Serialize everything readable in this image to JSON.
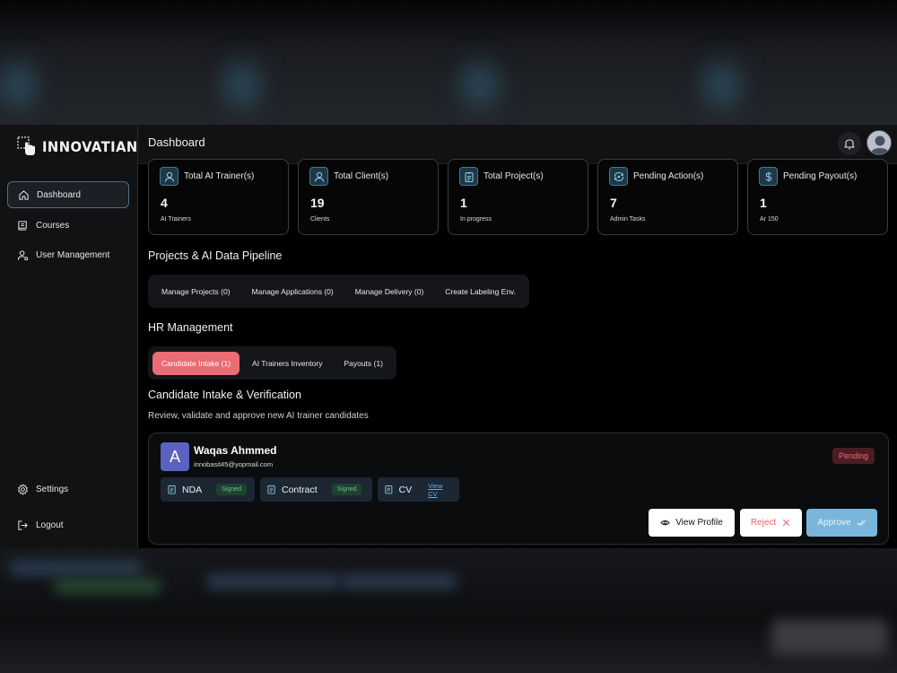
{
  "brand": {
    "name": "INNOVATIANA"
  },
  "sidebar": {
    "items": [
      {
        "label": "Dashboard",
        "icon": "home-icon",
        "active": true
      },
      {
        "label": "Courses",
        "icon": "courses-icon",
        "active": false
      },
      {
        "label": "User Management",
        "icon": "user-management-icon",
        "active": false
      }
    ],
    "bottom": [
      {
        "label": "Settings",
        "icon": "gear-icon"
      },
      {
        "label": "Logout",
        "icon": "logout-icon"
      }
    ]
  },
  "header": {
    "title": "Dashboard"
  },
  "stats": [
    {
      "title": "Total AI Trainer(s)",
      "value": "4",
      "sub": "AI Trainers",
      "icon": "user-icon"
    },
    {
      "title": "Total Client(s)",
      "value": "19",
      "sub": "Clients",
      "icon": "client-icon"
    },
    {
      "title": "Total Project(s)",
      "value": "1",
      "sub": "In progress",
      "icon": "clipboard-icon"
    },
    {
      "title": "Pending Action(s)",
      "value": "7",
      "sub": "Admin Tasks",
      "icon": "cycle-icon"
    },
    {
      "title": "Pending Payout(s)",
      "value": "1",
      "sub": "Ar 150",
      "icon": "dollar-icon"
    }
  ],
  "pipeline": {
    "title": "Projects & AI Data Pipeline",
    "tabs": [
      "Manage Projects (0)",
      "Manage Applications (0)",
      "Manage Delivery (0)",
      "Create Labeling Env."
    ]
  },
  "hr": {
    "title": "HR Management",
    "tabs": [
      "Candidate Intake (1)",
      "AI Trainers Inventory",
      "Payouts (1)"
    ]
  },
  "intake": {
    "title": "Candidate Intake & Verification",
    "subtitle": "Review, validate and approve new AI trainer candidates",
    "candidate": {
      "initial": "A",
      "name": "Waqas Ahmmed",
      "email": "innobasit45@yopmail.com",
      "status": "Pending",
      "documents": [
        {
          "name": "NDA",
          "status": "Signed"
        },
        {
          "name": "Contract",
          "status": "Signed"
        },
        {
          "name": "CV",
          "link": "View CV"
        }
      ],
      "actions": {
        "view": "View Profile",
        "reject": "Reject",
        "approve": "Approve"
      }
    }
  },
  "colors": {
    "accent": "#ea6c74",
    "approve": "#7ab6dc",
    "pending": "#ef6b74",
    "signed": "#6fbf8a",
    "icon_bg": "#1d3847"
  }
}
